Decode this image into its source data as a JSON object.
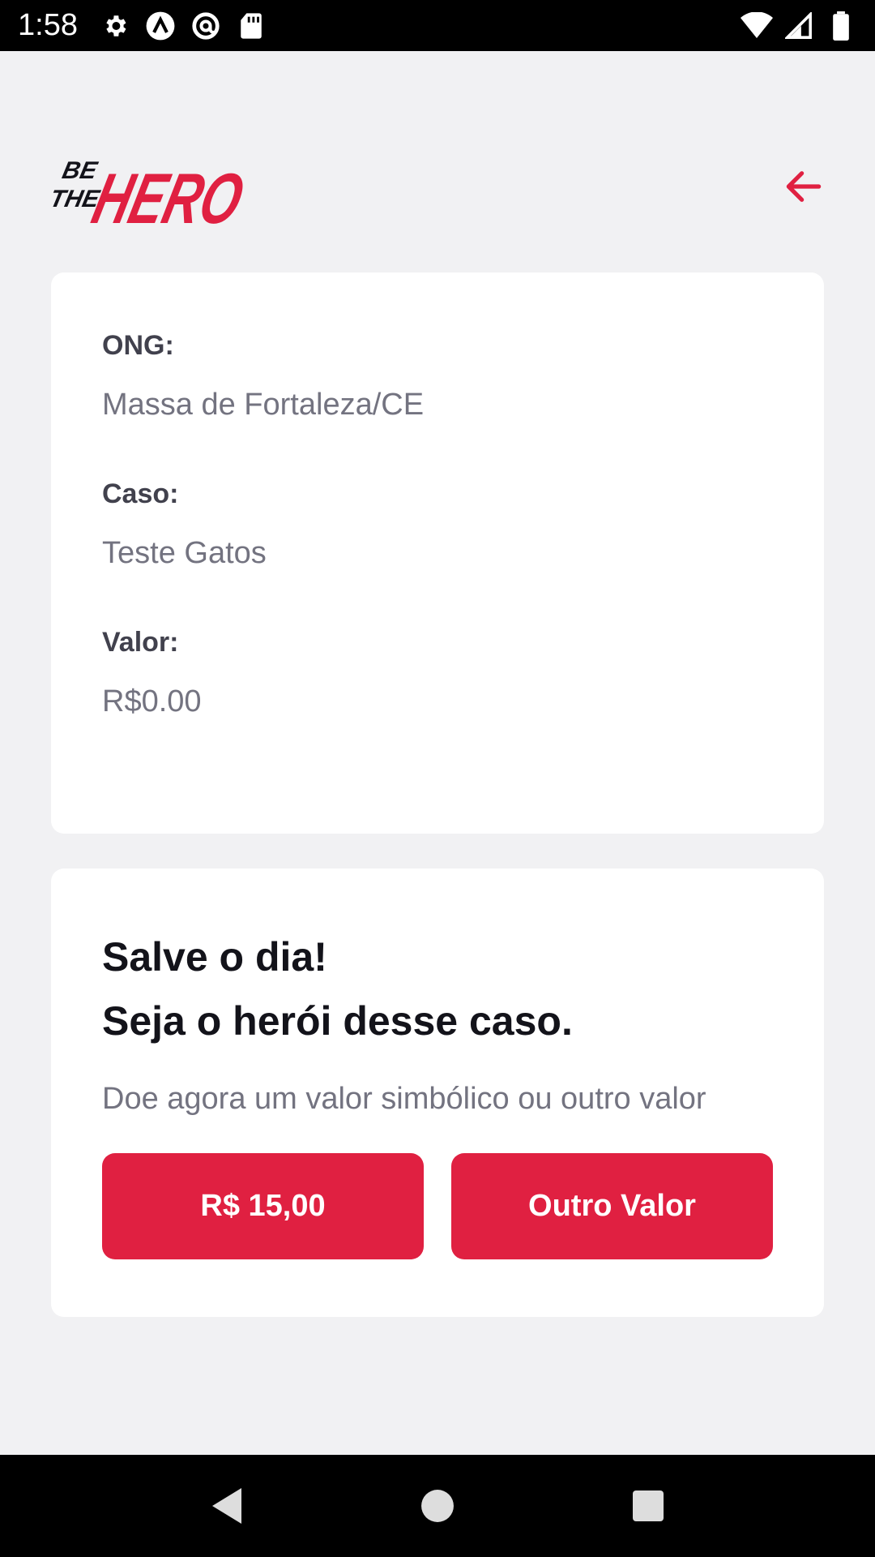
{
  "status_bar": {
    "time": "1:58",
    "left_icons": [
      "settings-icon",
      "app-a-icon",
      "at-sign-icon",
      "sd-card-icon"
    ],
    "right_icons": [
      "wifi-icon",
      "cell-signal-icon",
      "battery-icon"
    ]
  },
  "header": {
    "logo_small_text_1": "BE",
    "logo_small_text_2": "THE",
    "logo_big_text": "HERO",
    "back_icon": "arrow-left-icon"
  },
  "incident": {
    "ong_label": "ONG:",
    "ong_value": "Massa de Fortaleza/CE",
    "case_label": "Caso:",
    "case_value": "Teste Gatos",
    "value_label": "Valor:",
    "value_value": "R$0.00"
  },
  "contact": {
    "title_line_1": "Salve o dia!",
    "title_line_2": "Seja o herói desse caso.",
    "description": "Doe agora um valor simbólico ou outro valor",
    "button_1": "R$ 15,00",
    "button_2": "Outro Valor"
  },
  "nav_bar": {
    "icons": [
      "back-triangle-icon",
      "home-circle-icon",
      "recents-square-icon"
    ]
  },
  "colors": {
    "accent": "#e02041",
    "background": "#f0f0f5",
    "title": "#13131a",
    "label": "#41414d",
    "value": "#737380"
  }
}
